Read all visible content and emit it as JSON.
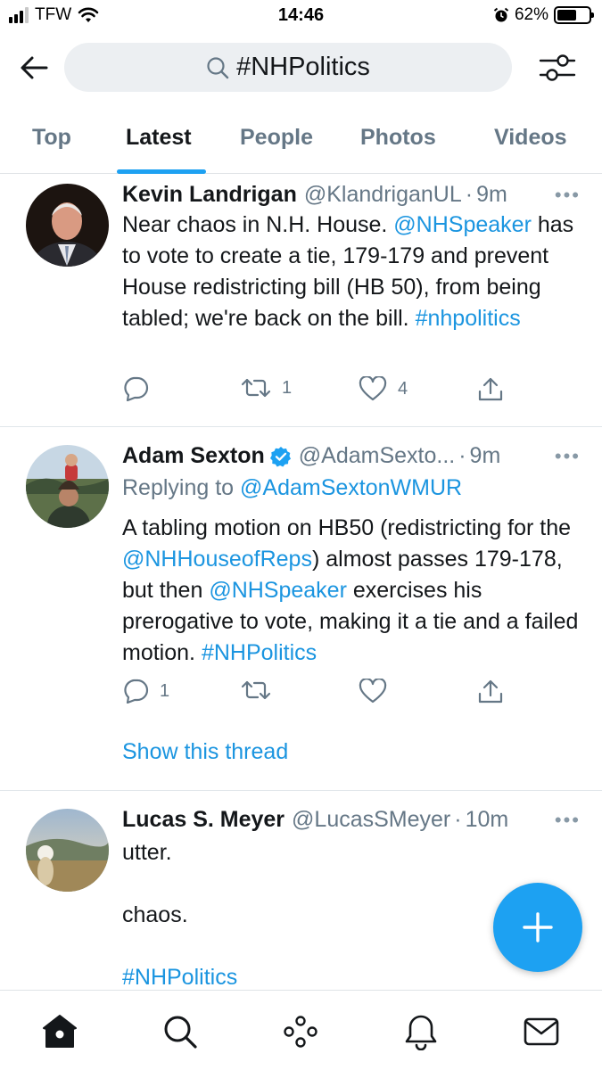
{
  "status_bar": {
    "carrier": "TFW",
    "time": "14:46",
    "battery_percent": "62%",
    "battery_level": 0.62,
    "signal_bars": 3,
    "icons": [
      "signal-icon",
      "wifi-icon",
      "alarm-icon",
      "battery-icon"
    ]
  },
  "header": {
    "back_icon": "back-arrow-icon",
    "search_query": "#NHPolitics",
    "search_icon": "search-icon",
    "filter_icon": "filter-sliders-icon"
  },
  "tabs": [
    {
      "label": "Top",
      "active": false
    },
    {
      "label": "Latest",
      "active": true
    },
    {
      "label": "People",
      "active": false
    },
    {
      "label": "Photos",
      "active": false
    },
    {
      "label": "Videos",
      "active": false
    }
  ],
  "tweets": [
    {
      "name": "Kevin Landrigan",
      "handle": "@KlandriganUL",
      "dot": "·",
      "time": "9m",
      "more": "•••",
      "text_parts": {
        "t1": "Near chaos in N.H. House. ",
        "m1": "@NHSpeaker",
        "t2": " has to vote to create a tie, 179-179 and prevent House redistricting bill (HB 50), from being tabled; we're back on the bill. ",
        "h1": "#nhpolitics"
      },
      "replies": "",
      "retweets": "1",
      "likes": "4"
    },
    {
      "name": "Adam Sexton",
      "verified": true,
      "handle": "@AdamSexto...",
      "dot": "·",
      "time": "9m",
      "more": "•••",
      "replying_prefix": "Replying to ",
      "replying_to": "@AdamSextonWMUR",
      "text_parts": {
        "t1": "A tabling motion on HB50 (redistricting for the ",
        "m1": "@NHHouseofReps",
        "t2": ") almost passes 179-178, but then ",
        "m2": "@NHSpeaker",
        "t3": " exercises his prerogative to vote, making it a tie and a failed motion. ",
        "h1": "#NHPolitics"
      },
      "replies": "1",
      "retweets": "",
      "likes": "",
      "show_thread": "Show this thread"
    },
    {
      "name": "Lucas S. Meyer",
      "handle": "@LucasSMeyer",
      "dot": "·",
      "time": "10m",
      "more": "•••",
      "lines": [
        "utter.",
        "chaos.",
        "#NHPolitics"
      ]
    }
  ],
  "fab": {
    "icon": "compose-plus-icon"
  },
  "bottom_nav": [
    {
      "icon": "home-icon",
      "active": true
    },
    {
      "icon": "search-icon",
      "active": false
    },
    {
      "icon": "spaces-icon",
      "active": false
    },
    {
      "icon": "notifications-bell-icon",
      "active": false
    },
    {
      "icon": "messages-mail-icon",
      "active": false
    }
  ],
  "colors": {
    "accent": "#1da1f2",
    "link": "#1b95e0",
    "text": "#14171a",
    "secondary": "#657786"
  }
}
